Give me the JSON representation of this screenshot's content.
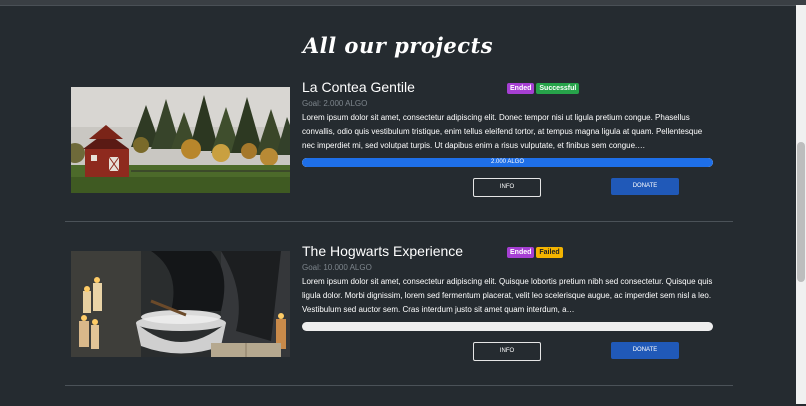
{
  "page_title": "All our projects",
  "projects": [
    {
      "name": "La Contea Gentile",
      "badges": [
        "Ended",
        "Successful"
      ],
      "goal": "Goal: 2.000 ALGO",
      "description": "Lorem ipsum dolor sit amet, consectetur adipiscing elit. Donec tempor nisi ut ligula pretium congue. Phasellus convallis, odio quis vestibulum tristique, enim tellus eleifend tortor, at tempus magna ligula at quam. Pellentesque nec imperdiet mi, sed volutpat turpis. Ut dapibus enim a risus vulputate, et finibus sem congue.…",
      "progress_fraction": 1.0,
      "progress_label": "2.000 ALGO",
      "info_label": "INFO",
      "donate_label": "DONATE",
      "image": "red-barn-forest-photo"
    },
    {
      "name": "The Hogwarts Experience",
      "badges": [
        "Ended",
        "Failed"
      ],
      "goal": "Goal: 10.000 ALGO",
      "description": "Lorem ipsum dolor sit amet, consectetur adipiscing elit. Quisque lobortis pretium nibh sed consectetur. Quisque quis ligula dolor. Morbi dignissim, lorem sed fermentum placerat, velit leo scelerisque augue, ac imperdiet sem nisl a leo. Vestibulum sed auctor sem. Cras interdum justo sit amet quam interdum, a…",
      "progress_fraction": 0.0,
      "progress_label": "",
      "info_label": "INFO",
      "donate_label": "DONATE",
      "image": "wizard-cauldron-candles-photo"
    }
  ],
  "colors": {
    "background": "#252b30",
    "badge_ended": "#a63fd3",
    "badge_successful": "#27a34a",
    "badge_failed": "#f4b400",
    "progress_fill": "#1e6fe8",
    "donate_button": "#2059b8"
  }
}
